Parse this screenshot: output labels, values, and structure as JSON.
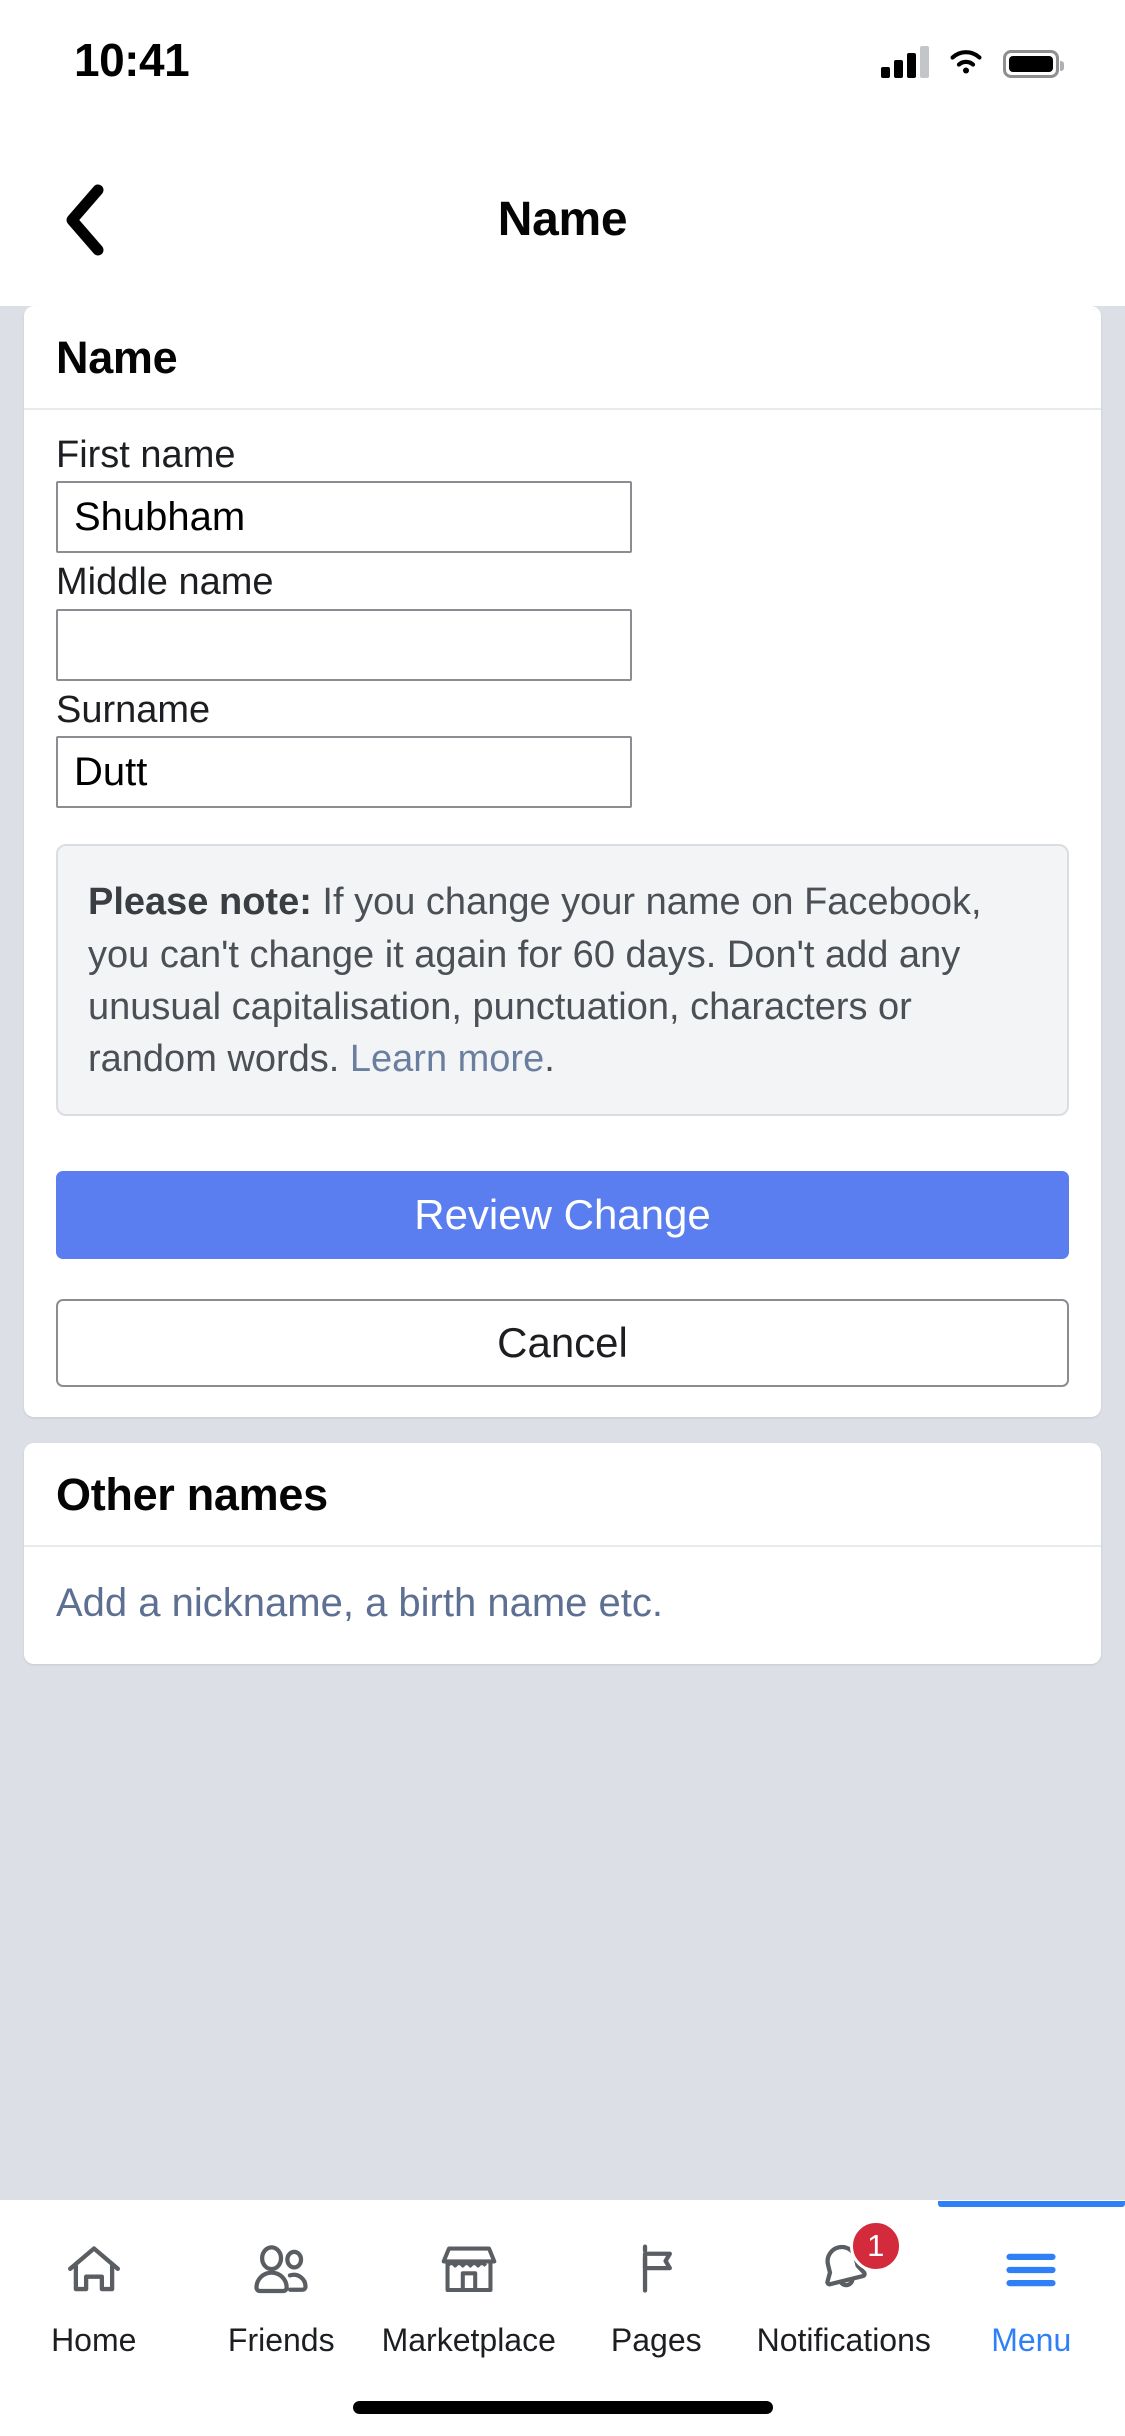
{
  "status_bar": {
    "time": "10:41",
    "cellular_icon": "cellular-signal-icon",
    "wifi_icon": "wifi-icon",
    "battery_icon": "battery-icon"
  },
  "header": {
    "back_icon": "back-chevron-icon",
    "title": "Name"
  },
  "name_card": {
    "title": "Name",
    "fields": [
      {
        "label": "First name",
        "value": "Shubham"
      },
      {
        "label": "Middle name",
        "value": ""
      },
      {
        "label": "Surname",
        "value": "Dutt"
      }
    ],
    "note": {
      "lead": "Please note:",
      "body": " If you change your name on Facebook, you can't change it again for 60 days. Don't add any unusual capitalisation, punctuation, characters or random words. ",
      "link": "Learn more",
      "end": "."
    },
    "primary_button": "Review Change",
    "secondary_button": "Cancel"
  },
  "other_names_card": {
    "title": "Other names",
    "link": "Add a nickname, a birth name etc."
  },
  "tabbar": {
    "items": [
      {
        "label": "Home",
        "icon": "home-icon",
        "active": false,
        "badge": ""
      },
      {
        "label": "Friends",
        "icon": "friends-icon",
        "active": false,
        "badge": ""
      },
      {
        "label": "Marketplace",
        "icon": "marketplace-icon",
        "active": false,
        "badge": ""
      },
      {
        "label": "Pages",
        "icon": "pages-flag-icon",
        "active": false,
        "badge": ""
      },
      {
        "label": "Notifications",
        "icon": "bell-icon",
        "active": false,
        "badge": "1"
      },
      {
        "label": "Menu",
        "icon": "hamburger-menu-icon",
        "active": true,
        "badge": ""
      }
    ]
  },
  "colors": {
    "accent_blue": "#2f80f7",
    "primary_button": "#5a7ef0",
    "badge_red": "#d32a3c",
    "page_background": "#dcdfe5",
    "link_blue": "#5d6f92"
  }
}
